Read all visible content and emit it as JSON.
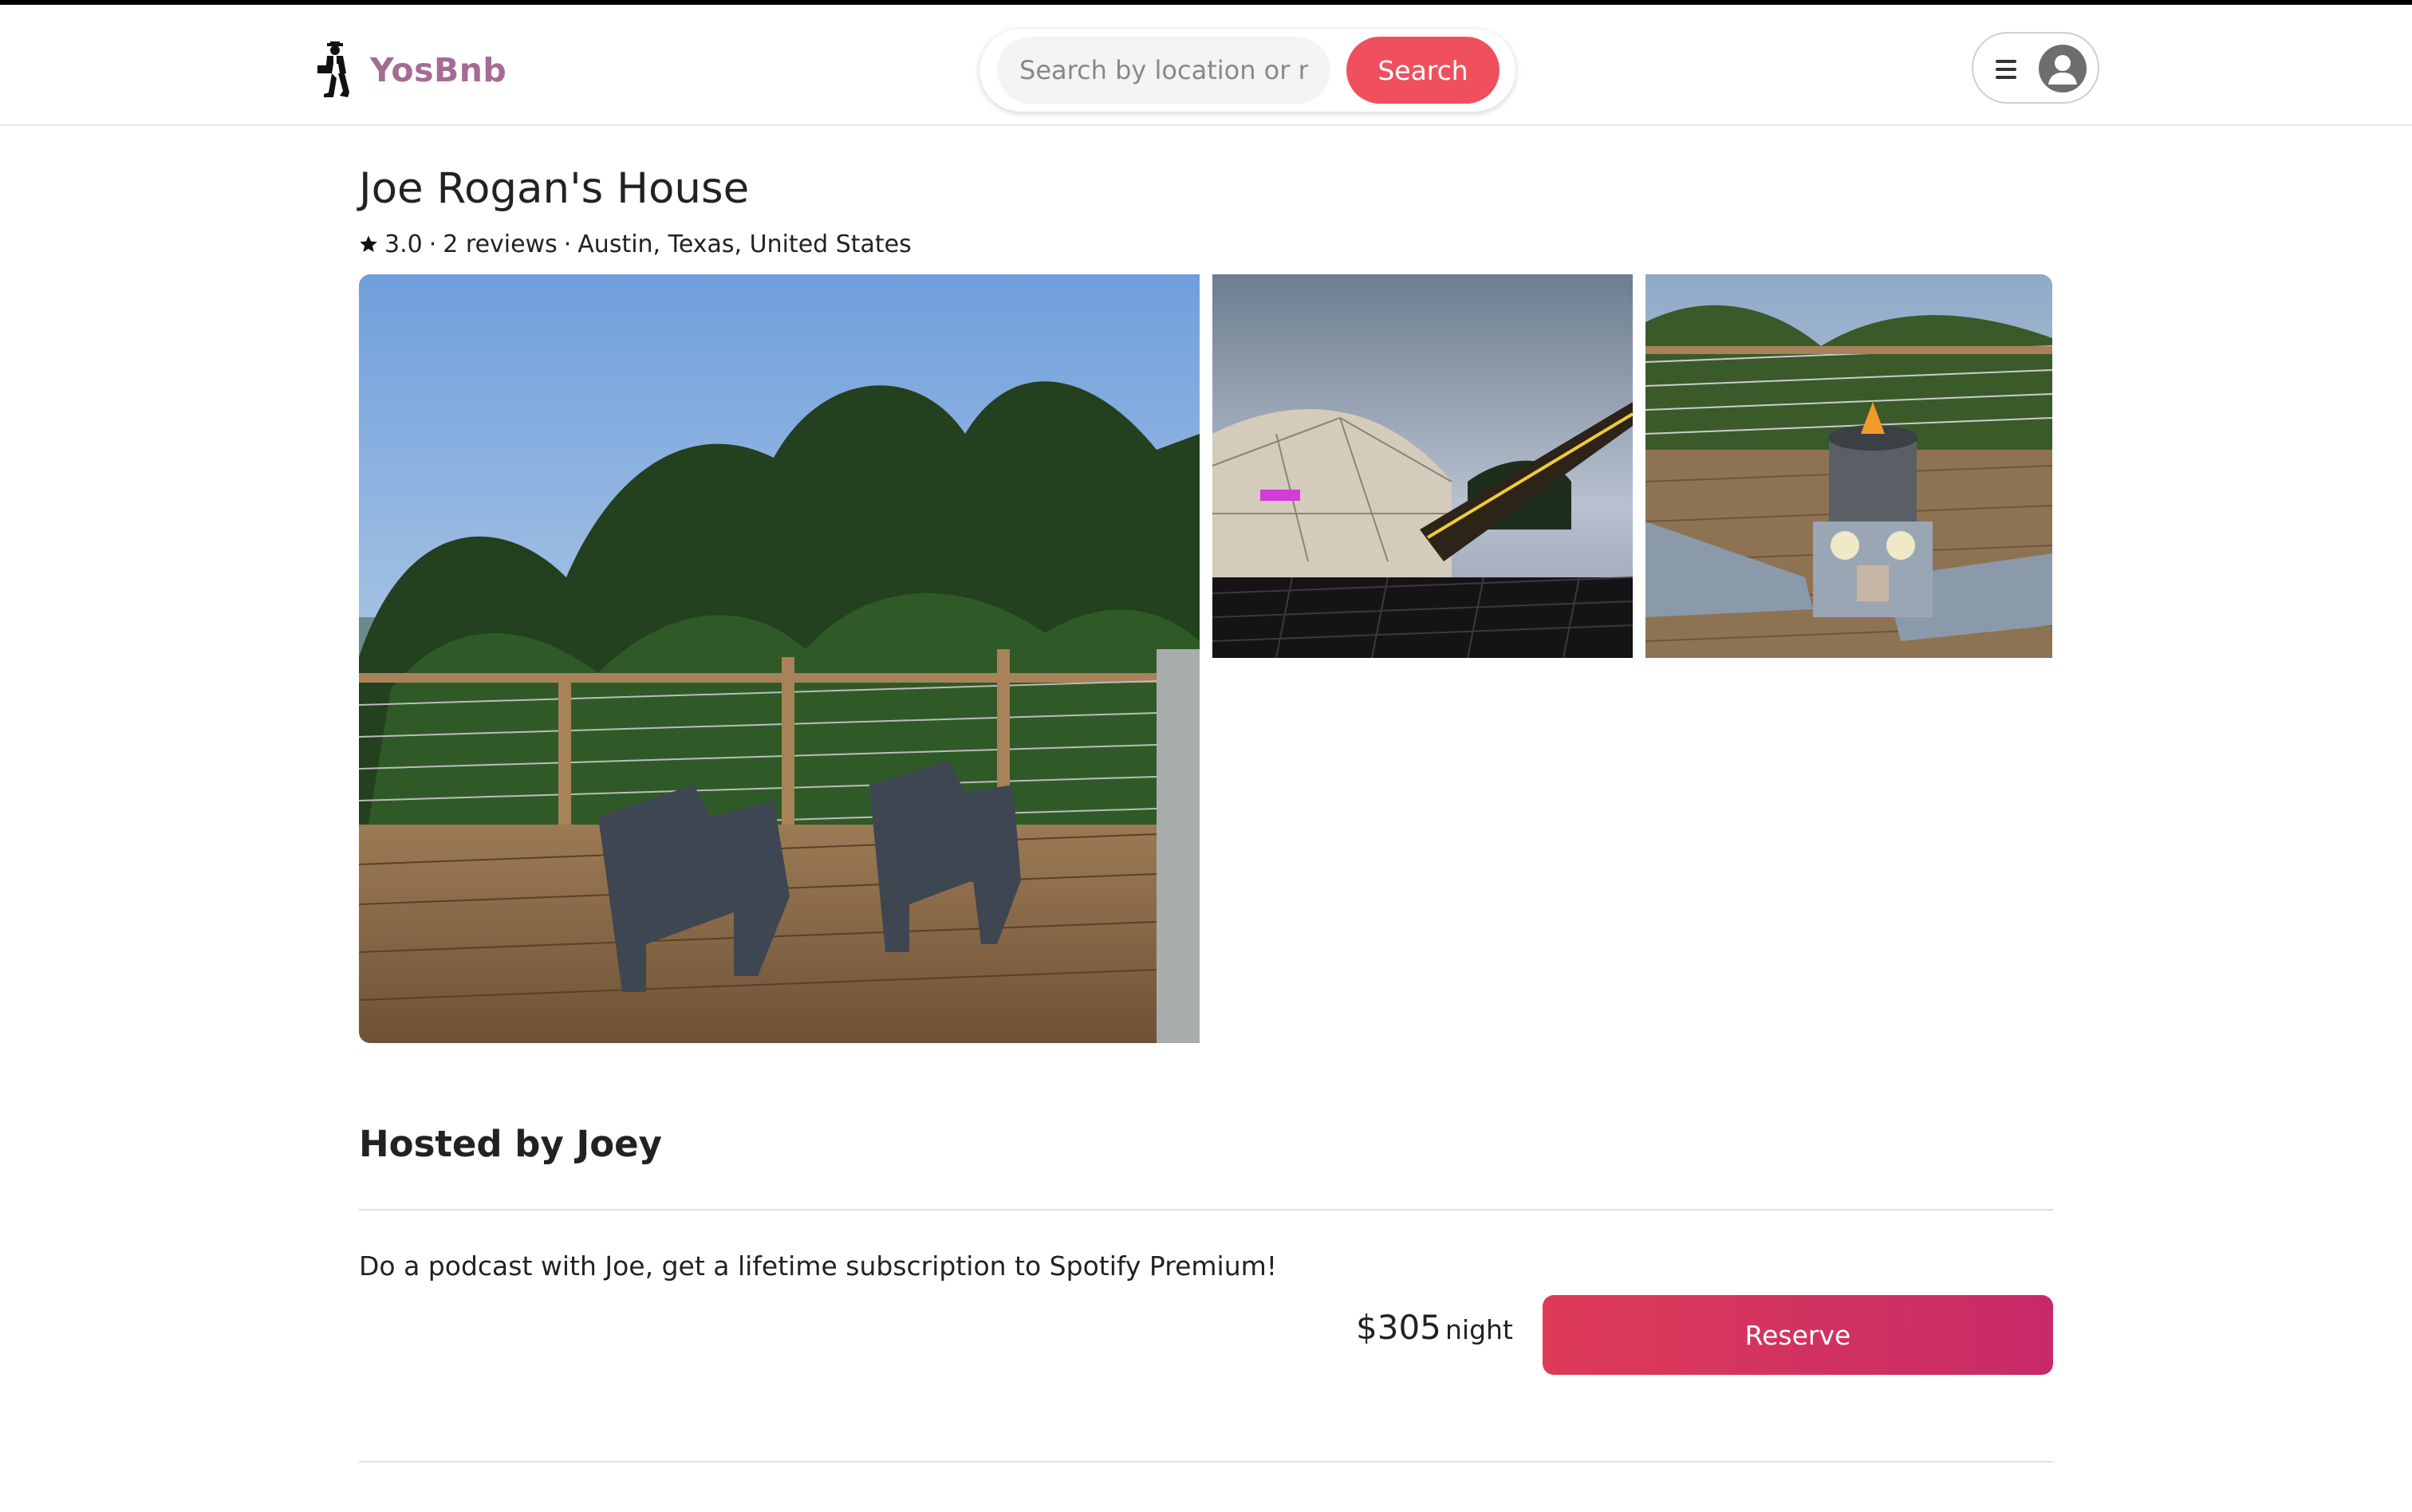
{
  "header": {
    "brand": {
      "name": "YosBnb",
      "logo_icon": "suited-man-logo-icon"
    },
    "search": {
      "placeholder": "Search by location or name",
      "button_label": "Search"
    },
    "user_menu": {
      "menu_icon": "hamburger-menu-icon",
      "avatar_icon": "user-avatar-icon"
    }
  },
  "listing": {
    "title": "Joe Rogan's House",
    "rating": "3.0",
    "separator": "·",
    "reviews": "2 reviews",
    "location": "Austin, Texas, United States",
    "photos": [
      {
        "subject": "deck-with-two-adirondack-chairs-photo"
      },
      {
        "subject": "geodesic-dome-with-string-lights-photo"
      },
      {
        "subject": "fire-pit-table-with-drinks-photo"
      }
    ],
    "host": "Hosted by Joey",
    "description": "Do a podcast with Joe, get a lifetime subscription to Spotify Premium!",
    "price": {
      "amount": "$305",
      "unit": "night"
    },
    "reserve_label": "Reserve"
  },
  "colors": {
    "brand": "#a56b95",
    "search_button": "#f0505e",
    "reserve_gradient_start": "#de3b58",
    "reserve_gradient_end": "#c72a68"
  }
}
